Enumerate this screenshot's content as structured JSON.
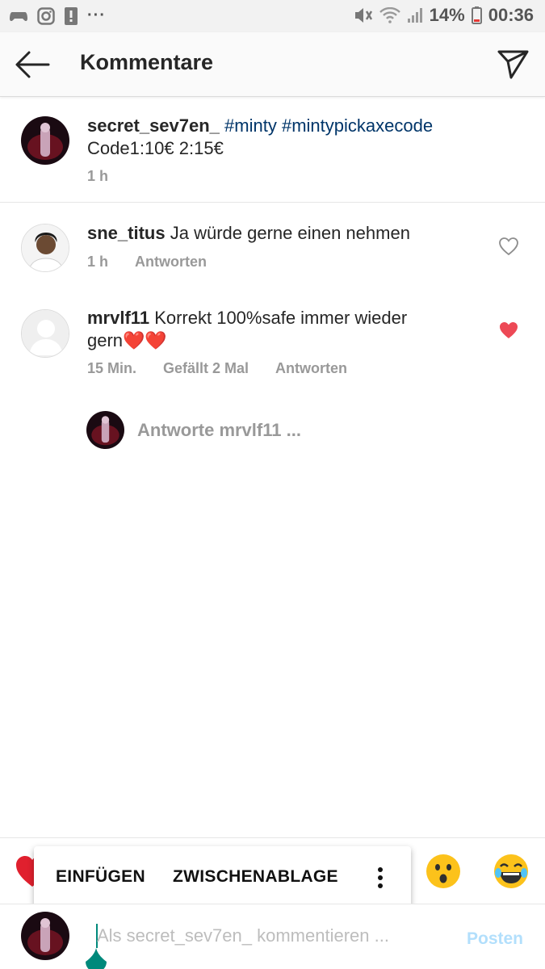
{
  "status_bar": {
    "battery_text": "14%",
    "time": "00:36",
    "more_dots": "···"
  },
  "header": {
    "title": "Kommentare"
  },
  "caption": {
    "username": "secret_sev7en_",
    "hashtags": "#minty #mintypickaxecode",
    "text": "Code1:10€  2:15€",
    "time": "1 h"
  },
  "comments": [
    {
      "username": "sne_titus",
      "text": "Ja würde gerne einen nehmen",
      "time": "1 h",
      "reply": "Antworten",
      "liked": false
    },
    {
      "username": "mrvlf11",
      "text_line1": "Korrekt 100%safe immer wieder",
      "text_line2": "gern❤️❤️",
      "time": "15 Min.",
      "likes": "Gefällt 2 Mal",
      "reply": "Antworten",
      "liked": true
    }
  ],
  "reply_prompt": "Antworte mrvlf11 ...",
  "popup": {
    "paste": "EINFÜGEN",
    "clipboard": "ZWISCHENABLAGE"
  },
  "emojis": [
    "heart",
    "hushed-face",
    "tears-of-joy"
  ],
  "input": {
    "placeholder": "Als secret_sev7en_ kommentieren ...",
    "post_label": "Posten"
  },
  "colors": {
    "hashtag": "#003569",
    "like_red": "#ed4956",
    "post_disabled": "#b2dffc",
    "meta_gray": "#999999"
  }
}
